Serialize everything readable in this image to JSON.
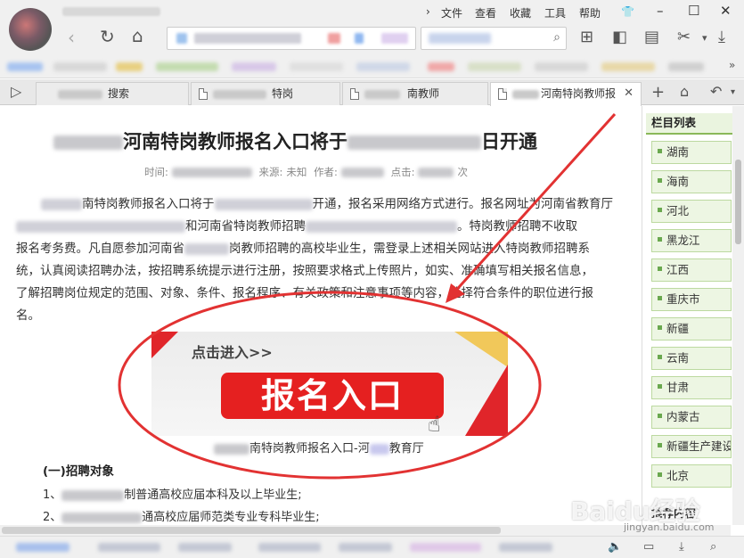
{
  "menu": {
    "file": "文件",
    "view": "查看",
    "favorites": "收藏",
    "tools": "工具",
    "help": "帮助"
  },
  "window_controls": {
    "minimize": "–",
    "maximize": "☐",
    "close": "✕"
  },
  "tabs": [
    {
      "label": "搜索",
      "active": false
    },
    {
      "label": "特岗",
      "active": false
    },
    {
      "label": "南教师",
      "active": false
    },
    {
      "label": "河南特岗教师报",
      "active": true
    }
  ],
  "article": {
    "title_main": "河南特岗教师报名入口将于",
    "title_end": "日开通",
    "meta": {
      "time_label": "时间:",
      "source_label": "来源:",
      "source_value": "未知",
      "author_label": "作者:",
      "clicks_label": "点击:",
      "clicks_unit": "次"
    },
    "para1_l1a": "南特岗教师报名入口将于",
    "para1_l1b": "开通，报名采用网络方式进行。报名网址为河南省教育厅",
    "para1_l2a": "和河南省特岗教师招聘",
    "para1_l2b": "。特岗教师招聘不收取",
    "para1_l3a": "报名考务费。凡自愿参加河南省",
    "para1_l3b": "岗教师招聘的高校毕业生，需登录上述相关网站进入特岗教师招聘系",
    "para1_l4": "统，认真阅读招聘办法，按招聘系统提示进行注册，按照要求格式上传照片，如实、准确填写相关报名信息，",
    "para1_l5": "了解招聘岗位规定的范围、对象、条件、报名程序、有关政策和注意事项等内容，选择符合条件的职位进行报",
    "para1_l6": "名。",
    "banner_enter": "点击进入>>",
    "banner_button": "报名入口",
    "banner_caption_a": "南特岗教师报名入口-河",
    "banner_caption_b": "教育厅",
    "section_title": "(一)招聘对象",
    "list1_num": "1、",
    "list1_text": "制普通高校应届本科及以上毕业生;",
    "list2_num": "2、",
    "list2_text": "通高校应届师范类专业专科毕业生;"
  },
  "sidebar": {
    "heading": "栏目列表",
    "items": [
      "湖南",
      "海南",
      "河北",
      "黑龙江",
      "江西",
      "重庆市",
      "新疆",
      "云南",
      "甘肃",
      "内蒙古",
      "新疆生产建设",
      "北京"
    ],
    "footer": "推荐内容"
  },
  "watermark": {
    "main": "Baidu经验",
    "sub": "jingyan.baidu.com"
  },
  "colors": {
    "accent_red": "#e52020",
    "sidebar_green": "#edf6e3"
  }
}
